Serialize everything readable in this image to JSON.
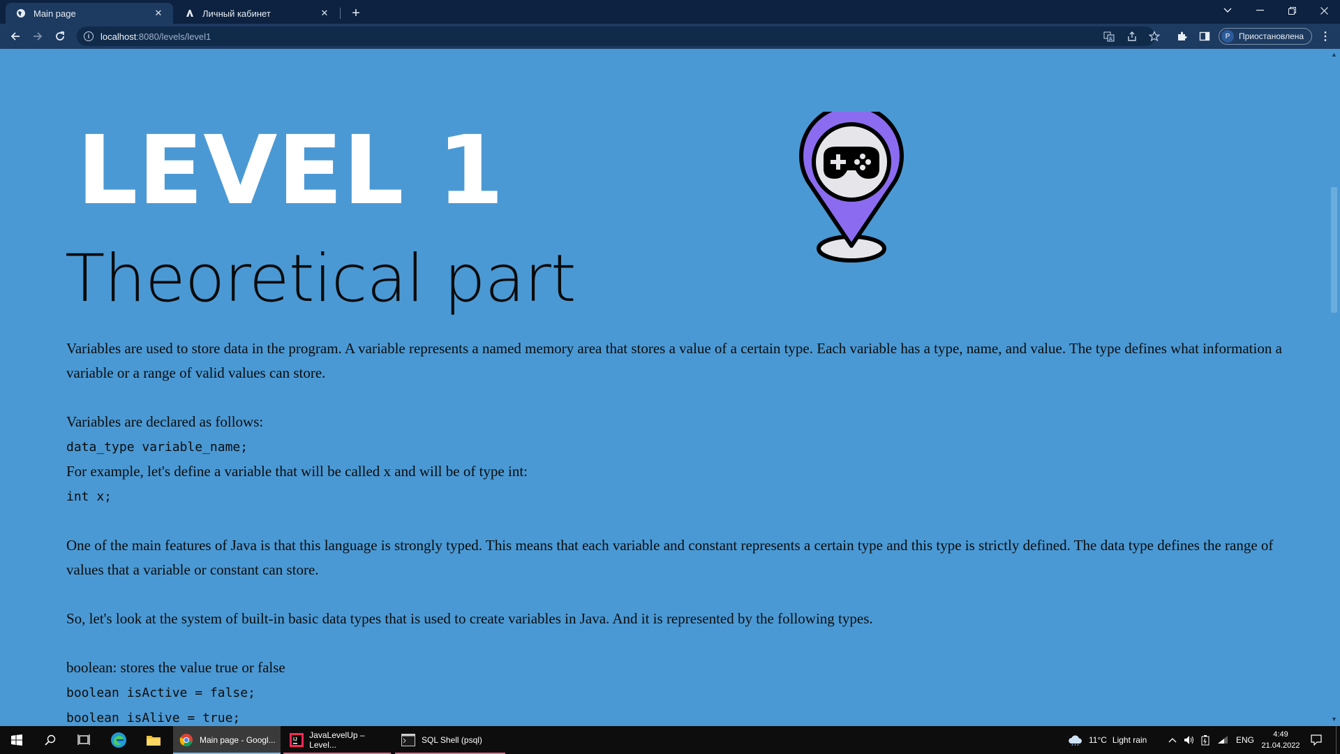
{
  "browser": {
    "tabs": [
      {
        "label": "Main page",
        "active": true
      },
      {
        "label": "Личный кабинет",
        "active": false
      }
    ],
    "address": {
      "host": "localhost",
      "path": ":8080/levels/level1"
    },
    "profile": {
      "initial": "P",
      "status": "Приостановлена"
    }
  },
  "page": {
    "level_title": "LEVEL 1",
    "heading": "Theoretical part",
    "paragraphs": [
      {
        "type": "text",
        "value": "Variables are used to store data in the program. A variable represents a named memory area that stores a value of a certain type. Each variable has a type, name, and value. The type defines what information a variable or a range of valid values can store."
      },
      {
        "type": "gap"
      },
      {
        "type": "text",
        "value": "Variables are declared as follows:"
      },
      {
        "type": "code",
        "value": "data_type variable_name;"
      },
      {
        "type": "text",
        "value": "For example, let's define a variable that will be called x and will be of type int:"
      },
      {
        "type": "code",
        "value": "int x;"
      },
      {
        "type": "gap"
      },
      {
        "type": "text",
        "value": "One of the main features of Java is that this language is strongly typed. This means that each variable and constant represents a certain type and this type is strictly defined. The data type defines the range of values that a variable or constant can store."
      },
      {
        "type": "gap"
      },
      {
        "type": "text",
        "value": "So, let's look at the system of built-in basic data types that is used to create variables in Java. And it is represented by the following types."
      },
      {
        "type": "gap"
      },
      {
        "type": "text",
        "value": "boolean: stores the value true or false"
      },
      {
        "type": "code",
        "value": "boolean isActive = false;"
      },
      {
        "type": "code",
        "value": "boolean isAlive = true;"
      }
    ],
    "logo_icon": "gamepad-location-pin-icon"
  },
  "taskbar": {
    "apps": [
      {
        "label": "Main page - Googl...",
        "icon": "chrome-icon",
        "active": true
      },
      {
        "label": "JavaLevelUp – Level...",
        "icon": "intellij-icon",
        "active": false
      },
      {
        "label": "SQL Shell (psql)",
        "icon": "terminal-icon",
        "active": false
      }
    ],
    "weather": {
      "temp": "11°C",
      "condition": "Light rain"
    },
    "language": "ENG",
    "time": "4:49",
    "date": "21.04.2022"
  },
  "colors": {
    "page_background": "#4a99d4",
    "tabstrip": "#0d2240",
    "toolbar": "#1d3a60",
    "pin_purple": "#8b6cf0",
    "taskbar": "#0d0d0d"
  }
}
